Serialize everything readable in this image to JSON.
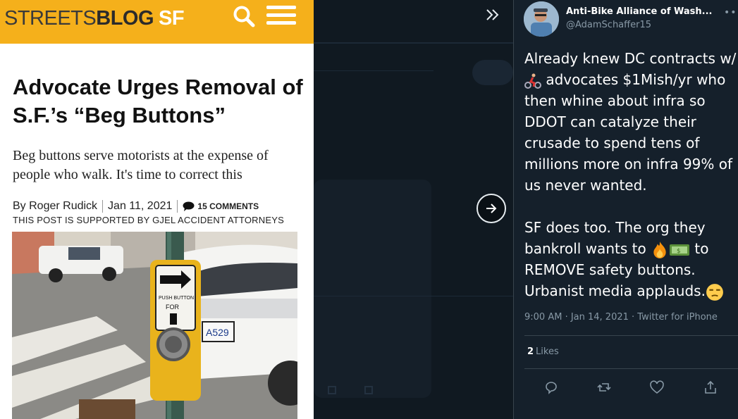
{
  "article": {
    "logo_streets": "STREETS",
    "logo_blog": "BLOG",
    "logo_sf": "SF",
    "title": "Advocate Urges Removal of S.F.’s “Beg Buttons”",
    "dek": "Beg buttons serve motorists at the expense of people who walk. It's time to correct this",
    "author": "By Roger Rudick",
    "date": "Jan 11, 2021",
    "comments": "15 COMMENTS",
    "sponsor": "THIS POST IS SUPPORTED BY GJEL ACCIDENT ATTORNEYS",
    "photo_sign_text": "PUSH BUTTON FOR",
    "photo_plate": "A529"
  },
  "tweet": {
    "display_name": "Anti-Bike Alliance of Wash...",
    "handle": "@AdamSchaffer15",
    "text_part1": "Already knew DC contracts w/ ",
    "text_part2": " advocates $1Mish/yr who then whine about infra so DDOT can catalyze their crusade to spend tens of millions more on infra 99% of us never wanted.\n\nSF does too. The org they bankroll wants to ",
    "text_part3": " to REMOVE safety buttons. Urbanist media applauds.",
    "timestamp": "9:00 AM · Jan 14, 2021 · Twitter for iPhone",
    "likes_count": "2",
    "likes_label": "Likes",
    "emoji_icons": [
      "cyclist-emoji",
      "fire-emoji",
      "money-emoji",
      "unamused-face-emoji"
    ]
  },
  "colors": {
    "streetsblog_yellow": "#f5b01b",
    "twitter_bg": "#15202b",
    "twitter_secondary": "#8899a6"
  }
}
